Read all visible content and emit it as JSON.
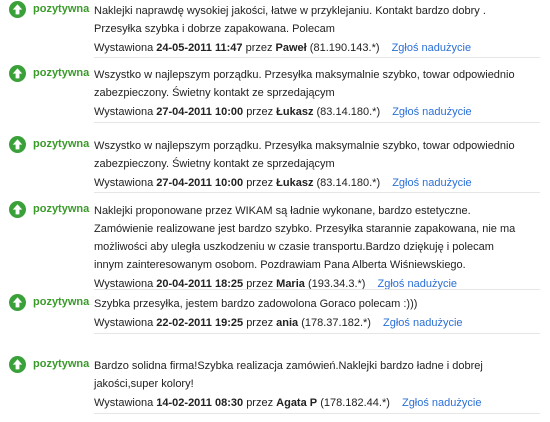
{
  "reviews": [
    {
      "type_label": "pozytywna",
      "icon": "up-arrow-circle-icon",
      "text": "Naklejki naprawdę wysokiej jakości, łatwe w przyklejaniu. Kontakt bardzo dobry . Przesyłka szybka i dobrze zapakowana. Polecam",
      "prefix": "Wystawiona",
      "date": "24-05-2011 11:47",
      "by": "przez",
      "author": "Paweł",
      "ip": "(81.190.143.*)",
      "report": "Zgłoś nadużycie"
    },
    {
      "type_label": "pozytywna",
      "icon": "up-arrow-circle-icon",
      "text": "Wszystko w najlepszym porządku. Przesyłka maksymalnie szybko, towar odpowiednio zabezpieczony. Świetny kontakt ze sprzedającym",
      "prefix": "Wystawiona",
      "date": "27-04-2011 10:00",
      "by": "przez",
      "author": "Łukasz",
      "ip": "(83.14.180.*)",
      "report": "Zgłoś nadużycie"
    },
    {
      "type_label": "pozytywna",
      "icon": "up-arrow-circle-icon",
      "text": "Wszystko w najlepszym porządku. Przesyłka maksymalnie szybko, towar odpowiednio zabezpieczony. Świetny kontakt ze sprzedającym",
      "prefix": "Wystawiona",
      "date": "27-04-2011 10:00",
      "by": "przez",
      "author": "Łukasz",
      "ip": "(83.14.180.*)",
      "report": "Zgłoś nadużycie"
    },
    {
      "type_label": "pozytywna",
      "icon": "up-arrow-circle-icon",
      "text": "Naklejki proponowane przez WIKAM są ładnie wykonane, bardzo estetyczne. Zamówienie realizowane jest bardzo szybko. Przesyłka starannie zapakowana, nie ma możliwości aby uległa uszkodzeniu w czasie transportu.Bardzo dziękuję i polecam innym zainteresowanym osobom. Pozdrawiam Pana Alberta Wiśniewskiego.",
      "prefix": "Wystawiona",
      "date": "20-04-2011 18:25",
      "by": "przez",
      "author": "Maria",
      "ip": "(193.34.3.*)",
      "report": "Zgłoś nadużycie"
    },
    {
      "type_label": "pozytywna",
      "icon": "up-arrow-circle-icon",
      "text": "Szybka przesyłka, jestem bardzo zadowolona Goraco polecam :)))",
      "prefix": "Wystawiona",
      "date": "22-02-2011 19:25",
      "by": "przez",
      "author": "ania",
      "ip": "(178.37.182.*)",
      "report": "Zgłoś nadużycie"
    },
    {
      "type_label": "pozytywna",
      "icon": "up-arrow-circle-icon",
      "text": "Bardzo solidna firma!Szybka realizacja zamówień.Naklejki bardzo ładne i dobrej jakości,super kolory!",
      "prefix": "Wystawiona",
      "date": "14-02-2011 08:30",
      "by": "przez",
      "author": "Agata P",
      "ip": "(178.182.44.*)",
      "report": "Zgłoś nadużycie"
    }
  ]
}
